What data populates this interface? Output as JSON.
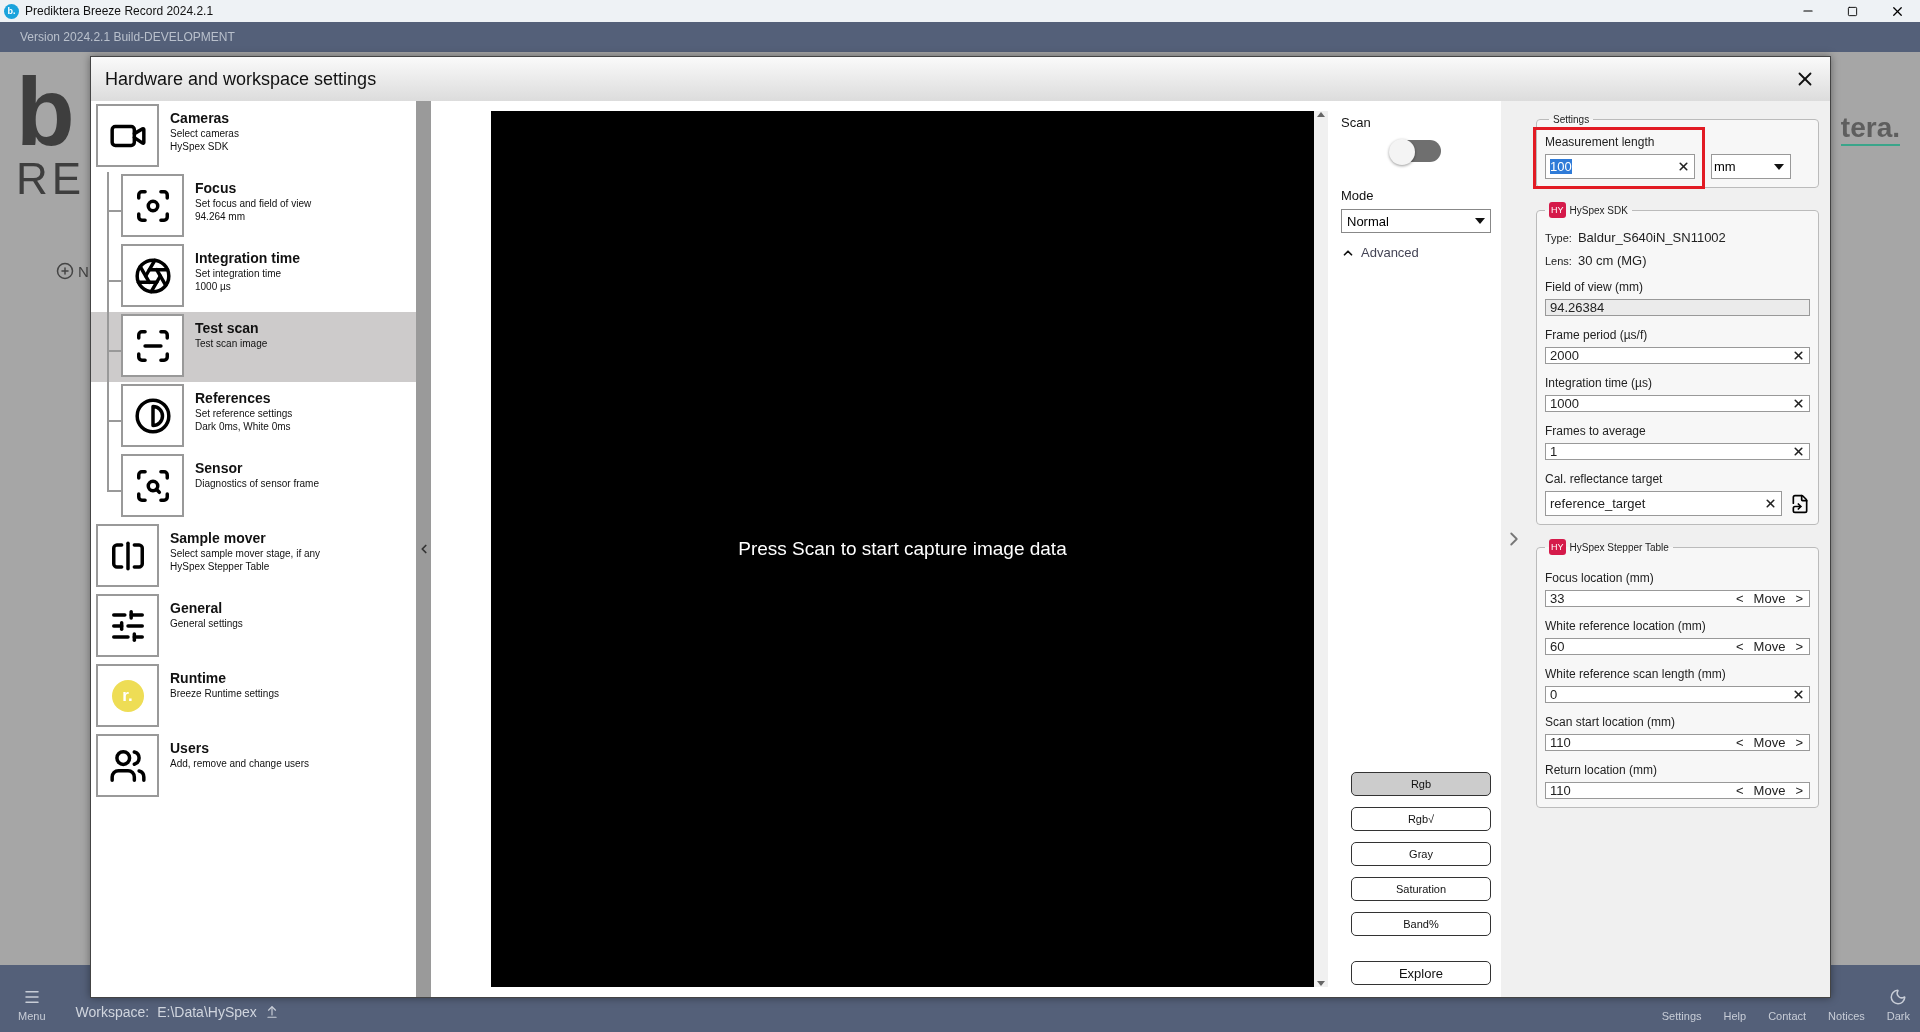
{
  "title_bar": {
    "app_icon": "b.",
    "title": "Prediktera Breeze Record 2024.2.1"
  },
  "version_bar": {
    "text": "Version 2024.2.1 Build-DEVELOPMENT"
  },
  "background": {
    "logo": "b",
    "subtitle": "RE",
    "new_button": "N",
    "brand": "tera."
  },
  "dialog": {
    "title": "Hardware and workspace settings",
    "nav": [
      {
        "title": "Cameras",
        "lines": [
          "Select cameras",
          "HySpex SDK"
        ],
        "selected": false,
        "children": [
          {
            "title": "Focus",
            "lines": [
              "Set focus and field of view",
              "94.264 mm"
            ],
            "selected": false
          },
          {
            "title": "Integration time",
            "lines": [
              "Set integration time",
              "1000 µs"
            ],
            "selected": false
          },
          {
            "title": "Test scan",
            "lines": [
              "Test scan image"
            ],
            "selected": true
          },
          {
            "title": "References",
            "lines": [
              "Set reference settings",
              "Dark 0ms, White 0ms"
            ],
            "selected": false
          },
          {
            "title": "Sensor",
            "lines": [
              "Diagnostics of sensor frame"
            ],
            "selected": false
          }
        ]
      },
      {
        "title": "Sample mover",
        "lines": [
          "Select sample mover stage, if any",
          "HySpex Stepper Table"
        ],
        "selected": false
      },
      {
        "title": "General",
        "lines": [
          "General settings"
        ],
        "selected": false
      },
      {
        "title": "Runtime",
        "lines": [
          "Breeze Runtime settings"
        ],
        "selected": false,
        "badge": "r."
      },
      {
        "title": "Users",
        "lines": [
          "Add, remove and change users"
        ],
        "selected": false
      }
    ]
  },
  "preview": {
    "message": "Press Scan to start capture image data"
  },
  "controls": {
    "scan": {
      "label": "Scan",
      "on": false
    },
    "mode": {
      "label": "Mode",
      "value": "Normal"
    },
    "advanced": {
      "label": "Advanced"
    },
    "views": [
      {
        "label": "Rgb",
        "selected": true
      },
      {
        "label": "Rgb√",
        "selected": false
      },
      {
        "label": "Gray",
        "selected": false
      },
      {
        "label": "Saturation",
        "selected": false
      },
      {
        "label": "Band%",
        "selected": false
      }
    ],
    "explore": "Explore"
  },
  "settings": {
    "legend": "Settings",
    "measurement": {
      "label": "Measurement length",
      "value": "100",
      "unit": "mm",
      "highlighted": true,
      "value_selected": true
    },
    "groups": [
      {
        "badge": "HY",
        "title": "HySpex SDK",
        "info": [
          {
            "label": "Type:",
            "value": "Baldur_S640iN_SN11002"
          },
          {
            "label": "Lens:",
            "value": "30 cm (MG)"
          }
        ],
        "fields": [
          {
            "kind": "readonly",
            "label": "Field of view (mm)",
            "value": "94.26384"
          },
          {
            "kind": "clear",
            "label": "Frame period (µs/f)",
            "value": "2000"
          },
          {
            "kind": "clear",
            "label": "Integration time (µs)",
            "value": "1000"
          },
          {
            "kind": "clear",
            "label": "Frames to average",
            "value": "1"
          },
          {
            "kind": "file",
            "label": "Cal. reflectance target",
            "value": "reference_target"
          }
        ]
      },
      {
        "badge": "HY",
        "title": "HySpex Stepper Table",
        "fields": [
          {
            "kind": "move",
            "label": "Focus location (mm)",
            "value": "33",
            "prev": "<",
            "move": "Move",
            "next": ">"
          },
          {
            "kind": "move",
            "label": "White reference location (mm)",
            "value": "60",
            "prev": "<",
            "move": "Move",
            "next": ">"
          },
          {
            "kind": "clear",
            "label": "White reference scan length (mm)",
            "value": "0"
          },
          {
            "kind": "move",
            "label": "Scan start location (mm)",
            "value": "110",
            "prev": "<",
            "move": "Move",
            "next": ">"
          },
          {
            "kind": "move",
            "label": "Return location (mm)",
            "value": "110",
            "prev": "<",
            "move": "Move",
            "next": ">"
          }
        ]
      }
    ]
  },
  "bottom_bar": {
    "menu": "Menu",
    "workspace_label": "Workspace:",
    "workspace_path": "E:\\Data\\HySpex",
    "items": [
      "Settings",
      "Help",
      "Contact",
      "Notices",
      "Dark"
    ]
  }
}
